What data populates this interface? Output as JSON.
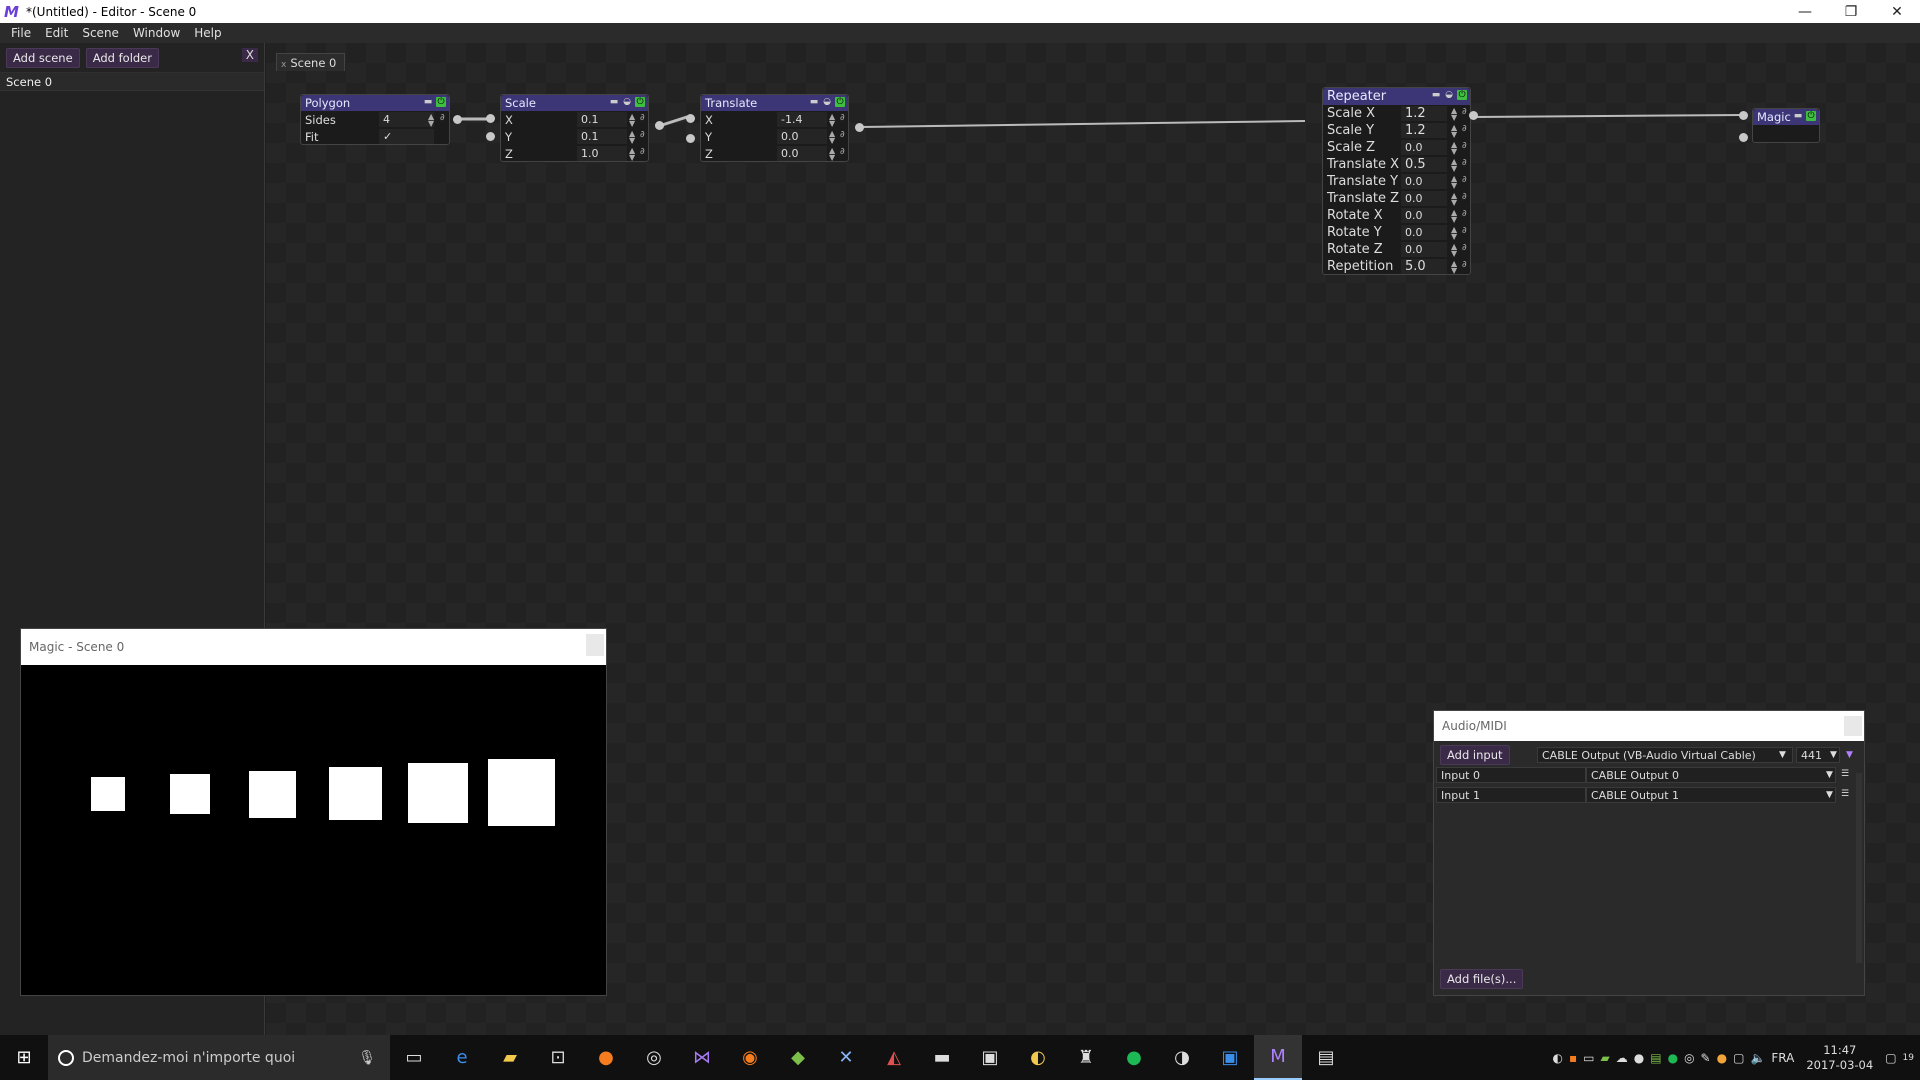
{
  "window": {
    "title": "*(Untitled) - Editor - Scene 0",
    "minimize": "—",
    "restore": "❐",
    "close": "✕"
  },
  "menu": [
    "File",
    "Edit",
    "Scene",
    "Window",
    "Help"
  ],
  "left_panel": {
    "add_scene": "Add scene",
    "add_folder": "Add folder",
    "close": "X",
    "scenes": [
      "Scene 0"
    ]
  },
  "tab": {
    "label": "Scene 0",
    "close": "x"
  },
  "nodes": {
    "polygon": {
      "title": "Polygon",
      "rows": [
        {
          "label": "Sides",
          "value": "4"
        },
        {
          "label": "Fit",
          "value": "✓"
        }
      ]
    },
    "scale": {
      "title": "Scale",
      "rows": [
        {
          "label": "X",
          "value": "0.1"
        },
        {
          "label": "Y",
          "value": "0.1"
        },
        {
          "label": "Z",
          "value": "1.0"
        }
      ]
    },
    "translate": {
      "title": "Translate",
      "rows": [
        {
          "label": "X",
          "value": "-1.4"
        },
        {
          "label": "Y",
          "value": "0.0"
        },
        {
          "label": "Z",
          "value": "0.0"
        }
      ]
    },
    "repeater": {
      "title": "Repeater",
      "rows": [
        {
          "label": "Scale X",
          "value": "1.2"
        },
        {
          "label": "Scale Y",
          "value": "1.2"
        },
        {
          "label": "Scale Z",
          "value": "0.0"
        },
        {
          "label": "Translate X",
          "value": "0.5"
        },
        {
          "label": "Translate Y",
          "value": "0.0"
        },
        {
          "label": "Translate Z",
          "value": "0.0"
        },
        {
          "label": "Rotate X",
          "value": "0.0"
        },
        {
          "label": "Rotate Y",
          "value": "0.0"
        },
        {
          "label": "Rotate Z",
          "value": "0.0"
        },
        {
          "label": "Repetition",
          "value": "5.0"
        }
      ]
    },
    "magic": {
      "title": "Magic"
    }
  },
  "preview_window": {
    "title": "Magic - Scene 0"
  },
  "audio_window": {
    "title": "Audio/MIDI",
    "add_input": "Add input",
    "device": "CABLE Output (VB-Audio Virtual Cable)",
    "rate": "441",
    "inputs": [
      {
        "name": "Input 0",
        "source": "CABLE Output 0"
      },
      {
        "name": "Input 1",
        "source": "CABLE Output 1"
      }
    ],
    "add_files": "Add file(s)..."
  },
  "taskbar": {
    "search_placeholder": "Demandez-moi n'importe quoi",
    "lang": "FRA",
    "time": "11:47",
    "date": "2017-03-04",
    "notif_count": "19"
  },
  "colors": {
    "node_header": "#3c3576",
    "enabled": "#3fbf3f",
    "button": "#3a2a48"
  }
}
